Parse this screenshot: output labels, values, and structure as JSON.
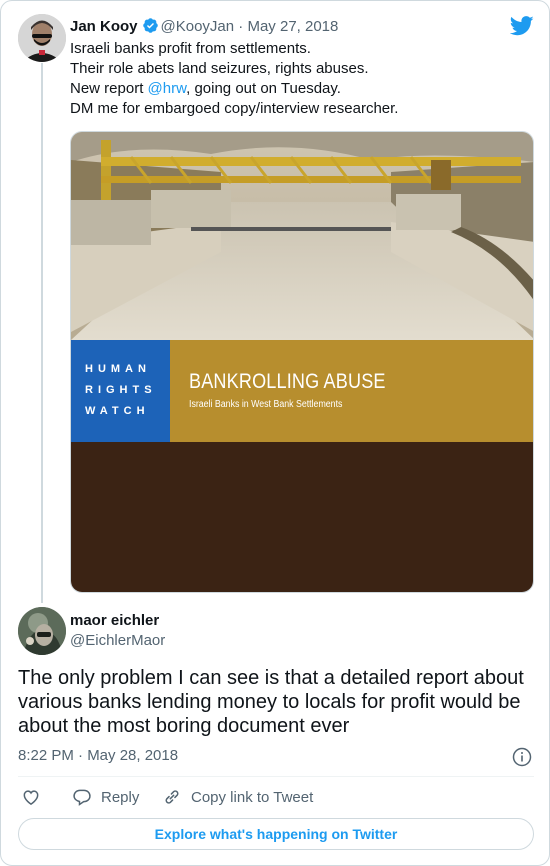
{
  "colors": {
    "accent": "#1d9bf0",
    "text": "#0f1419",
    "muted": "#536471",
    "border": "#cfd9de",
    "hrw_blue": "#1d63b8",
    "cover_gold": "#b78e2e",
    "cover_brown": "#3b2314"
  },
  "tweet": {
    "author_name": "Jan Kooy",
    "handle": "@KooyJan",
    "separator": "·",
    "date": "May 27, 2018",
    "lines": {
      "l1": "Israeli banks profit from settlements.",
      "l2": "Their role abets land seizures, rights abuses.",
      "l3_prefix": "New report ",
      "l3_mention": "@hrw",
      "l3_suffix": ", going out on Tuesday.",
      "l4": "DM me for embargoed copy/interview researcher."
    },
    "image": {
      "hrw_line1": "HUMAN",
      "hrw_line2": "RIGHTS",
      "hrw_line3": "WATCH",
      "title": "BANKROLLING ABUSE",
      "subtitle": "Israeli Banks in West Bank Settlements"
    }
  },
  "reply": {
    "author_name": "maor eichler",
    "handle": "@EichlerMaor",
    "lines": {
      "l1": "The only problem I can see is that a detailed report about",
      "l2": "various banks lending money to locals for profit would be",
      "l3": "about the most boring document ever"
    },
    "timestamp": "8:22 PM · May 28, 2018"
  },
  "actions": {
    "reply_label": "Reply",
    "copy_label": "Copy link to Tweet"
  },
  "explore_label": "Explore what's happening on Twitter",
  "icons": {
    "verified": "verified-badge-icon",
    "logo": "twitter-bird-icon",
    "info": "info-icon",
    "like": "heart-icon",
    "reply": "speech-bubble-icon",
    "copy": "link-icon"
  }
}
